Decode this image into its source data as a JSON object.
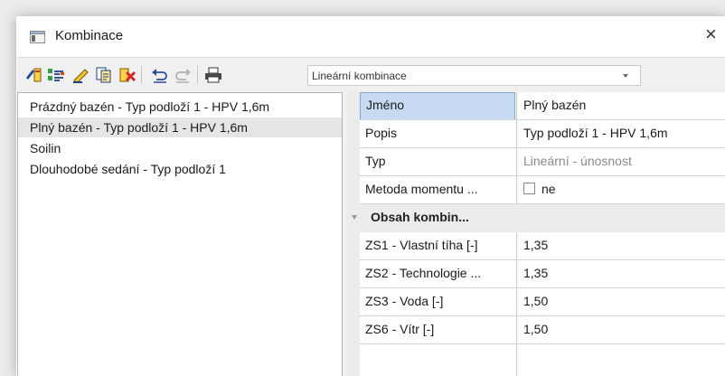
{
  "window": {
    "title": "Kombinace",
    "close_glyph": "×"
  },
  "toolbar": {
    "buttons": [
      {
        "name": "new-combination-icon"
      },
      {
        "name": "generate-combinations-icon"
      },
      {
        "name": "edit-icon"
      },
      {
        "name": "copy-icon"
      },
      {
        "name": "delete-icon"
      },
      {
        "name": "undo-icon"
      },
      {
        "name": "redo-icon"
      },
      {
        "name": "print-icon"
      }
    ],
    "combo": {
      "value": "Lineární kombinace"
    }
  },
  "list": {
    "items": [
      {
        "label": "Prázdný bazén - Typ podloží 1 - HPV 1,6m",
        "selected": false
      },
      {
        "label": "Plný bazén - Typ podloží 1 - HPV 1,6m",
        "selected": true
      },
      {
        "label": "Soilin",
        "selected": false
      },
      {
        "label": "Dlouhodobé sedání - Typ podloží 1",
        "selected": false
      }
    ]
  },
  "properties": {
    "rows": [
      {
        "name": "Jméno",
        "value": "Plný bazén"
      },
      {
        "name": "Popis",
        "value": "Typ podloží 1 - HPV 1,6m"
      },
      {
        "name": "Typ",
        "value": "Lineární - únosnost"
      },
      {
        "name": "Metoda momentu ...",
        "value": "ne"
      }
    ],
    "category": {
      "label": "Obsah kombin..."
    },
    "load_rows": [
      {
        "name": "ZS1 - Vlastní tíha [-]",
        "value": "1,35"
      },
      {
        "name": "ZS2 - Technologie ...",
        "value": "1,35"
      },
      {
        "name": "ZS3 - Voda [-]",
        "value": "1,50"
      },
      {
        "name": "ZS6 - Vítr [-]",
        "value": "1,50"
      }
    ]
  },
  "colors": {
    "selection": "#c6dbf1",
    "list_selection": "#e5e5e5",
    "category_bg": "#ececec"
  }
}
